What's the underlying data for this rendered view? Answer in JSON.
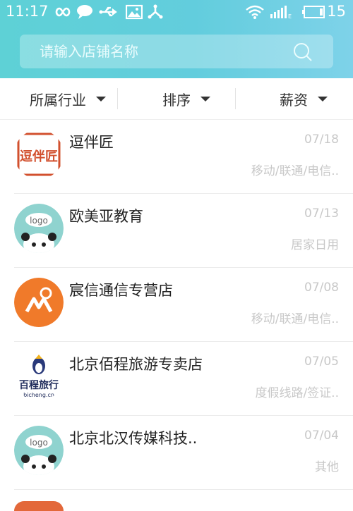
{
  "statusbar": {
    "time": "11:17",
    "battery": "15"
  },
  "search": {
    "placeholder": "请输入店铺名称"
  },
  "filters": [
    {
      "label": "所属行业"
    },
    {
      "label": "排序"
    },
    {
      "label": "薪资"
    }
  ],
  "stores": [
    {
      "name": "逗伴匠",
      "date": "07/18",
      "category": "移动/联通/电信..",
      "logo_text": "逗伴匠"
    },
    {
      "name": "欧美亚教育",
      "date": "07/13",
      "category": "居家日用",
      "logo_text": "logo"
    },
    {
      "name": "宸信通信专营店",
      "date": "07/08",
      "category": "移动/联通/电信..",
      "logo_text": ""
    },
    {
      "name": "北京佰程旅游专卖店",
      "date": "07/05",
      "category": "度假线路/签证..",
      "logo_text": "百程旅行",
      "logo_subtext": "bicheng.cn"
    },
    {
      "name": "北京北汉传媒科技..",
      "date": "07/04",
      "category": "其他",
      "logo_text": "logo"
    }
  ],
  "colors": {
    "header_start": "#5ed1d6",
    "header_end": "#7ed2e9",
    "muted": "#c8c8c8"
  }
}
